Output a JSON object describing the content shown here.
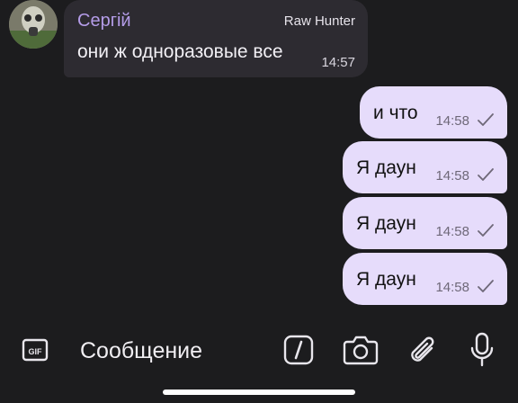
{
  "incoming": {
    "sender": "Сергій",
    "badge": "Raw Hunter",
    "text": "они ж одноразовые все",
    "time": "14:57"
  },
  "outgoing": [
    {
      "text": "и что",
      "time": "14:58"
    },
    {
      "text": "Я даун",
      "time": "14:58"
    },
    {
      "text": "Я даун",
      "time": "14:58"
    },
    {
      "text": "Я даун",
      "time": "14:58"
    }
  ],
  "composer": {
    "placeholder": "Сообщение",
    "icons": [
      "gif-icon",
      "command-slash-icon",
      "camera-icon",
      "paperclip-icon",
      "microphone-icon"
    ]
  },
  "colors": {
    "background": "#1c1c1e",
    "incoming_bubble": "#2d2b31",
    "outgoing_bubble": "#e6dcfb",
    "sender_name": "#b49ce8"
  }
}
